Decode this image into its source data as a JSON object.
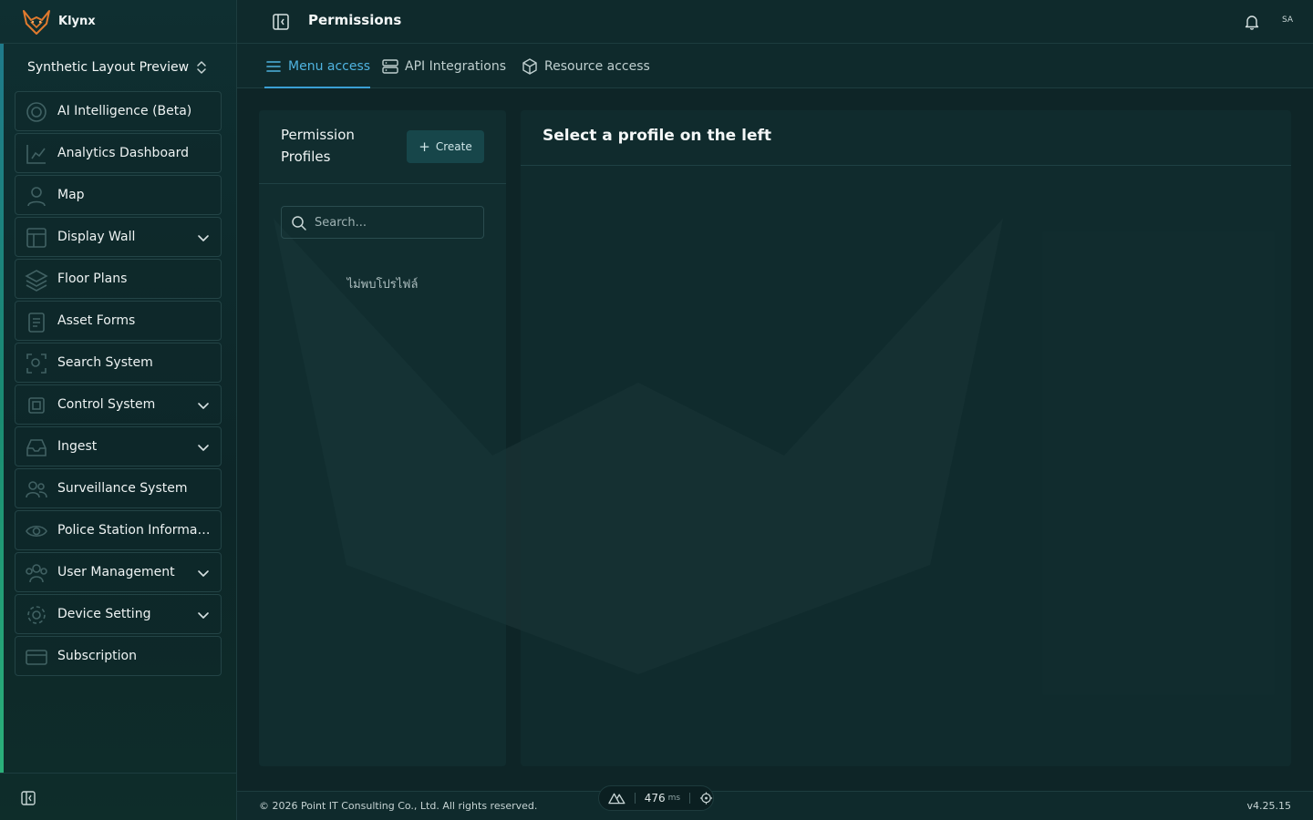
{
  "app": {
    "brand": "Klynx",
    "workspace": "Synthetic Layout Preview"
  },
  "sidebar": {
    "items": [
      {
        "label": "AI Intelligence (Beta)",
        "icon": "target-icon",
        "expandable": false
      },
      {
        "label": "Analytics Dashboard",
        "icon": "chart-icon",
        "expandable": false
      },
      {
        "label": "Map",
        "icon": "map-pin-icon",
        "expandable": false
      },
      {
        "label": "Display Wall",
        "icon": "layout-icon",
        "expandable": true
      },
      {
        "label": "Floor Plans",
        "icon": "layers-icon",
        "expandable": false
      },
      {
        "label": "Asset Forms",
        "icon": "clipboard-icon",
        "expandable": false
      },
      {
        "label": "Search System",
        "icon": "scan-search-icon",
        "expandable": false
      },
      {
        "label": "Control System",
        "icon": "cpu-icon",
        "expandable": true
      },
      {
        "label": "Ingest",
        "icon": "inbox-icon",
        "expandable": true
      },
      {
        "label": "Surveillance System",
        "icon": "users-icon",
        "expandable": false
      },
      {
        "label": "Police Station Informati...",
        "icon": "eye-icon",
        "expandable": false
      },
      {
        "label": "User Management",
        "icon": "user-group-icon",
        "expandable": true
      },
      {
        "label": "Device Setting",
        "icon": "gear-icon",
        "expandable": true
      },
      {
        "label": "Subscription",
        "icon": "credit-card-icon",
        "expandable": false
      }
    ]
  },
  "header": {
    "title": "Permissions",
    "avatar_initials": "SA"
  },
  "tabs": [
    {
      "label": "Menu access",
      "active": true
    },
    {
      "label": "API Integrations",
      "active": false
    },
    {
      "label": "Resource access",
      "active": false
    }
  ],
  "profiles": {
    "title": "Permission Profiles",
    "create_label": "Create",
    "search_placeholder": "Search...",
    "empty_message": "ไม่พบโปรไฟล์"
  },
  "detail": {
    "title": "Select a profile on the left"
  },
  "footer": {
    "copyright": "© 2026 Point IT Consulting Co., Ltd. All rights reserved.",
    "version": "v4.25.15",
    "perf_value": "476",
    "perf_unit": "ms"
  },
  "colors": {
    "accent": "#4fb3e0",
    "background": "#10282a"
  }
}
